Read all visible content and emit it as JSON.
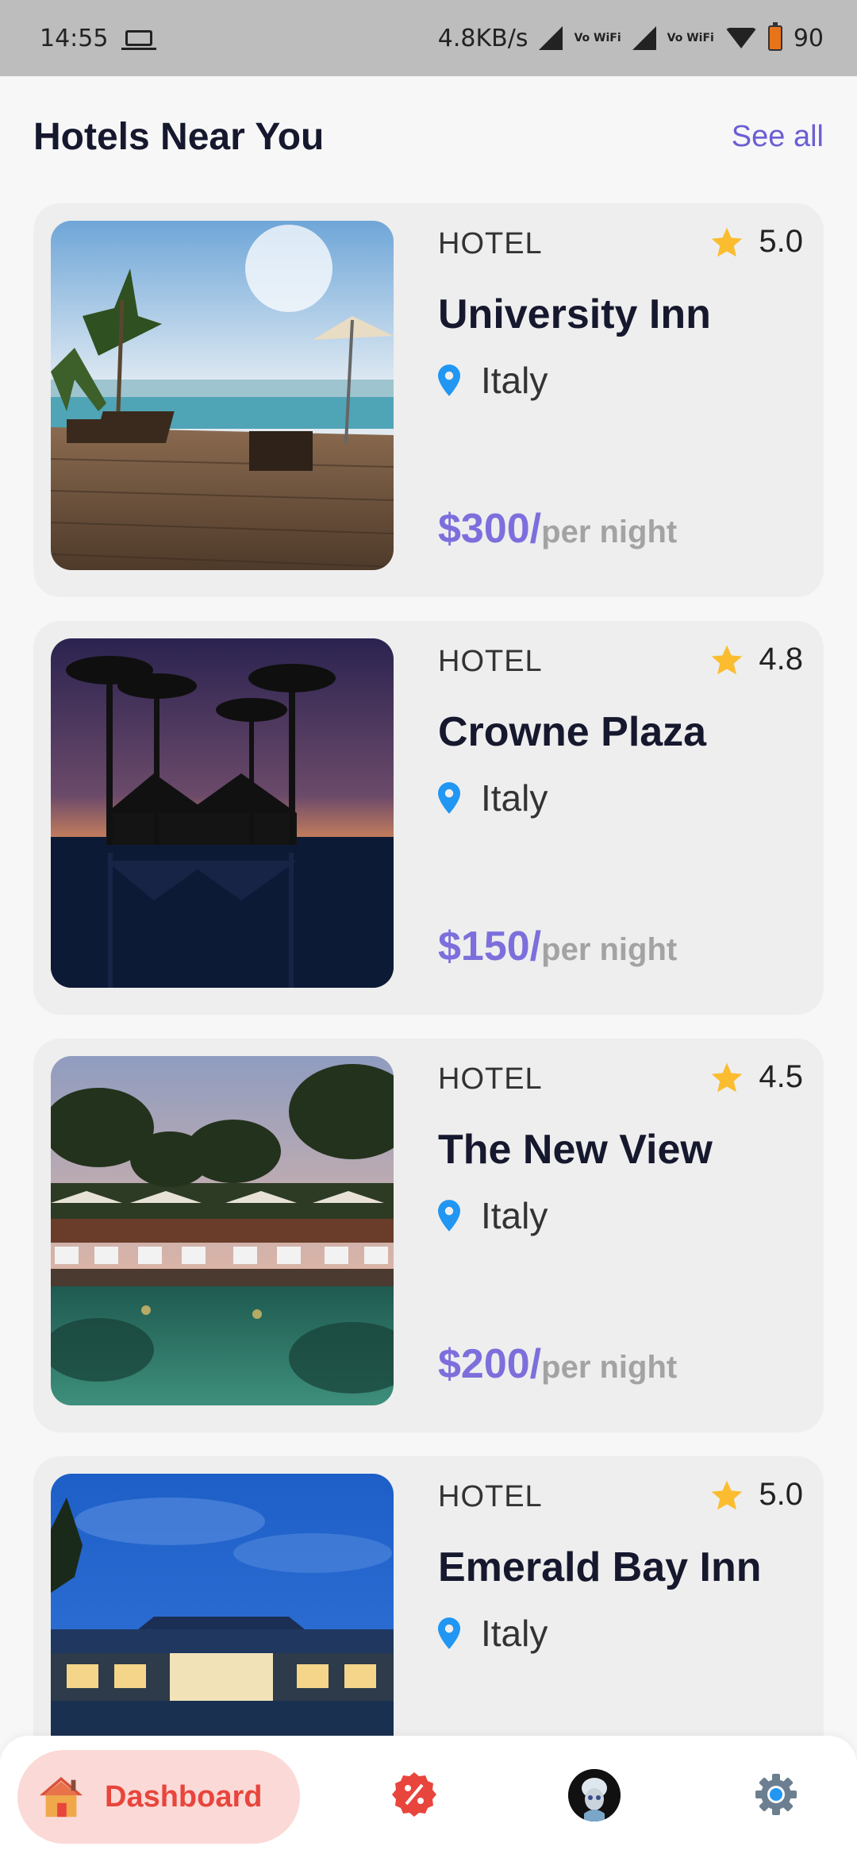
{
  "status_bar": {
    "time": "14:55",
    "net_speed": "4.8KB/s",
    "vowifi_1": "Vo WiFi",
    "vowifi_2": "Vo WiFi",
    "battery": "90"
  },
  "section": {
    "title": "Hotels Near You",
    "see_all": "See all"
  },
  "hotels": [
    {
      "type": "HOTEL",
      "rating": "5.0",
      "name": "University Inn",
      "location": "Italy",
      "price": "$300/",
      "unit": "per night"
    },
    {
      "type": "HOTEL",
      "rating": "4.8",
      "name": "Crowne Plaza",
      "location": "Italy",
      "price": "$150/",
      "unit": "per night"
    },
    {
      "type": "HOTEL",
      "rating": "4.5",
      "name": "The New View",
      "location": "Italy",
      "price": "$200/",
      "unit": "per night"
    },
    {
      "type": "HOTEL",
      "rating": "5.0",
      "name": "Emerald Bay Inn",
      "location": "Italy",
      "price": "",
      "unit": ""
    }
  ],
  "bottom_nav": {
    "dashboard_label": "Dashboard",
    "icons": [
      "house-icon",
      "discount-icon",
      "avatar",
      "gear-icon"
    ]
  },
  "colors": {
    "accent": "#7c6fdc",
    "see_all": "#6b5fd3",
    "star": "#fbbd2f",
    "pin": "#2196f3",
    "nav_active_bg": "#fbd9d6",
    "nav_active_text": "#e8453c"
  }
}
